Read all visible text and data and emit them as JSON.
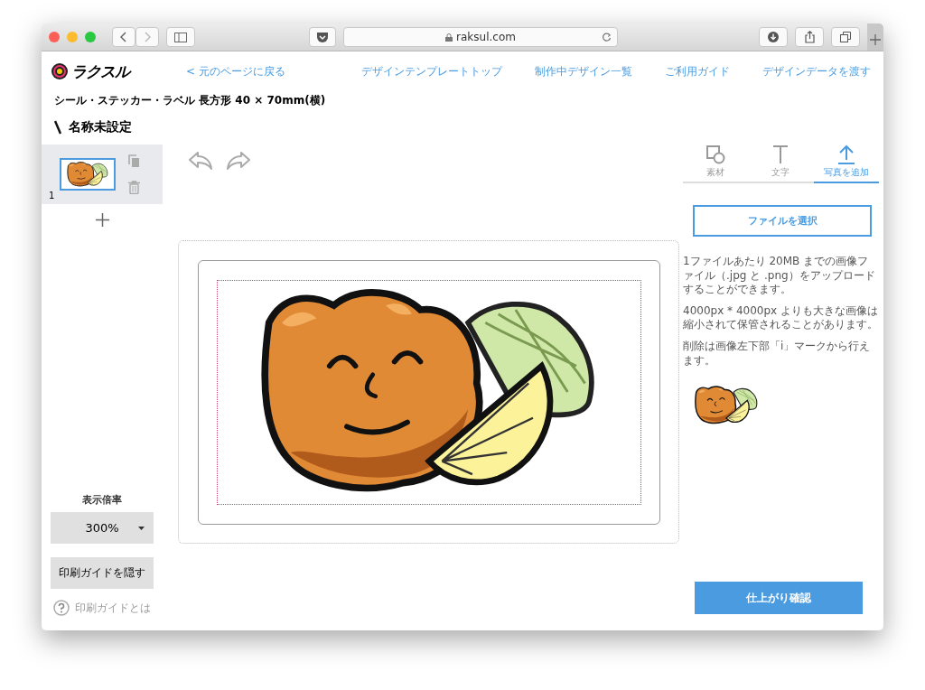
{
  "browser": {
    "url": "raksul.com"
  },
  "header": {
    "logo": "ラクスル",
    "back_link": "< 元のページに戻る",
    "nav": [
      "デザインテンプレートトップ",
      "制作中デザイン一覧",
      "ご利用ガイド",
      "デザインデータを渡す"
    ]
  },
  "product": "シール・ステッカー・ラベル 長方形 40 × 70mm(横)",
  "design_name": "名称未設定",
  "pages": [
    {
      "number": "1",
      "selected": true
    }
  ],
  "zoom": {
    "label": "表示倍率",
    "value": "300%"
  },
  "hide_guide_button": "印刷ガイドを隠す",
  "guide_help_link": "印刷ガイドとは",
  "tabs": [
    {
      "label": "素材",
      "kind": "shapes",
      "selected": false
    },
    {
      "label": "文字",
      "kind": "text",
      "selected": false
    },
    {
      "label": "写真を追加",
      "kind": "upload",
      "selected": true
    }
  ],
  "file_button": "ファイルを選択",
  "notes": [
    "1ファイルあたり 20MB までの画像ファイル（.jpg と .png）をアップロードすることができます。",
    "4000px * 4000px よりも大きな画像は縮小されて保管されることがあります。",
    "削除は画像左下部「i」マークから行えます。"
  ],
  "confirm_button": "仕上がり確認"
}
